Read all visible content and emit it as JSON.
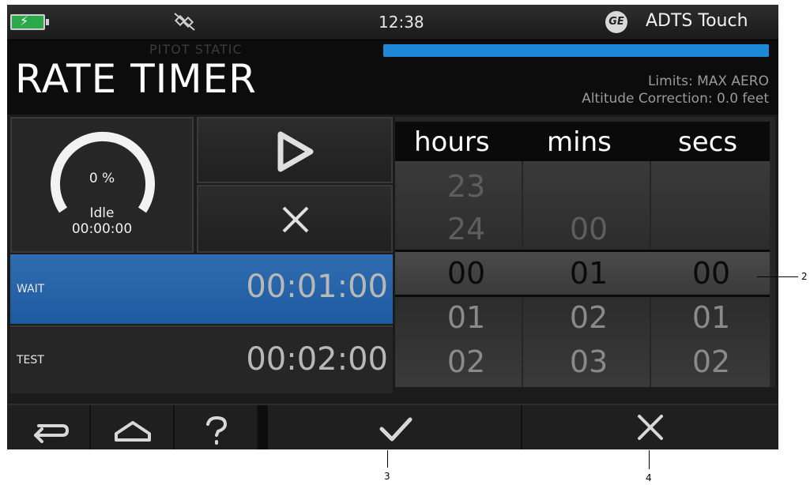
{
  "status": {
    "time": "12:38",
    "brand": "GE",
    "app_name": "ADTS Touch"
  },
  "header": {
    "mode": "PITOT STATIC",
    "title": "RATE TIMER",
    "limits": "Limits: MAX AERO",
    "altitude_correction": "Altitude Correction: 0.0 feet",
    "progress_fraction": 1.0,
    "progress_color": "#1e88d8"
  },
  "gauge": {
    "percent": "0 %",
    "status": "Idle",
    "elapsed": "00:00:00"
  },
  "rows": {
    "wait": {
      "label": "WAIT",
      "value": "00:01:00"
    },
    "test": {
      "label": "TEST",
      "value": "00:02:00"
    }
  },
  "picker": {
    "headers": {
      "hours": "hours",
      "mins": "mins",
      "secs": "secs"
    },
    "hours": [
      "23",
      "24",
      "00",
      "01",
      "02"
    ],
    "mins": [
      "00",
      "01",
      "02",
      "03"
    ],
    "secs": [
      "00",
      "01",
      "02"
    ]
  },
  "icons": {
    "battery": "battery-charging-icon",
    "plug": "disconnected-plug-icon",
    "play": "play-icon",
    "stop": "close-icon",
    "back": "back-arrow-icon",
    "home": "home-icon",
    "help": "help-icon",
    "accept": "check-icon",
    "cancel": "close-icon"
  },
  "callouts": {
    "c2": "2",
    "c3": "3",
    "c4": "4"
  }
}
